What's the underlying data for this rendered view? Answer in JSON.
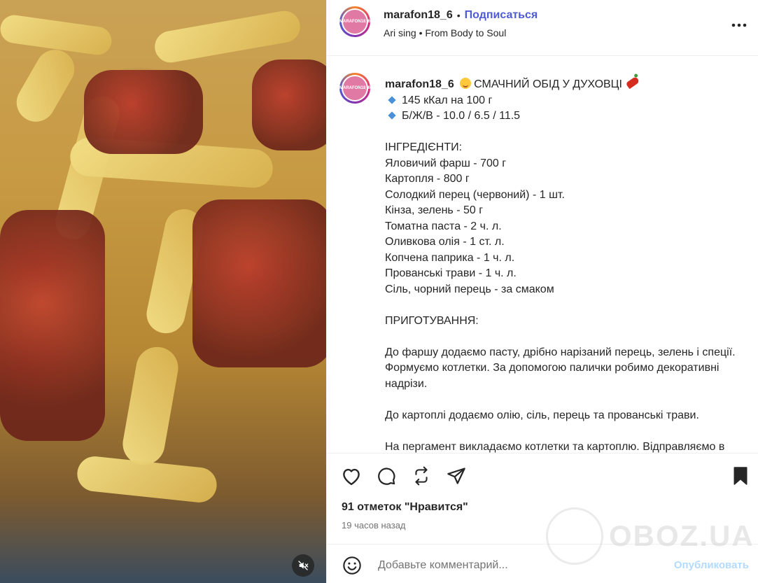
{
  "header": {
    "username": "marafon18_6",
    "separator": "•",
    "follow_label": "Подписаться",
    "audio_artist": "Ari sing",
    "audio_separator": "•",
    "audio_track": "From Body to Soul",
    "avatar_text": "MARAFON18_6"
  },
  "caption": {
    "username": "marafon18_6",
    "title": "СМАЧНИЙ ОБІД У ДУХОВЦІ",
    "kcal": "145 кКал на 100 г",
    "macros": "Б/Ж/В - 10.0 / 6.5 / 11.5",
    "ingredients_heading": "ІНГРЕДІЄНТИ:",
    "ingredients": [
      "Яловичий фарш - 700 г",
      "Картопля - 800 г",
      "Солодкий перец (червоний) - 1 шт.",
      "Кінза, зелень - 50 г",
      "Томатна паста - 2 ч. л.",
      "Оливкова олія - 1 ст. л.",
      "Копчена паприка - 1 ч. л.",
      "Прованські трави - 1 ч. л.",
      "Сіль, чорний перець - за смаком"
    ],
    "preparation_heading": "ПРИГОТУВАННЯ:",
    "step1": "До фаршу додаємо пасту, дрібно нарізаний перець, зелень і спеції. Формуємо котлетки. За допомогою палички робимо декоративні надрізи.",
    "step2": "До картоплі додаємо олію, сіль, перець та прованські трави.",
    "step3": "На пергамент викладаємо котлетки та картоплю. Відправляємо в"
  },
  "stats": {
    "likes": "91 отметок \"Нравится\"",
    "time_ago": "19 часов назад"
  },
  "comment": {
    "placeholder": "Добавьте комментарий...",
    "publish_label": "Опубликовать"
  },
  "watermark": {
    "text": "OBOZ.UA"
  },
  "colors": {
    "follow": "#4f5bd5",
    "publish": "#b3dbff",
    "diamond": "#4a8fd8",
    "text": "#262626",
    "muted": "#737373"
  }
}
